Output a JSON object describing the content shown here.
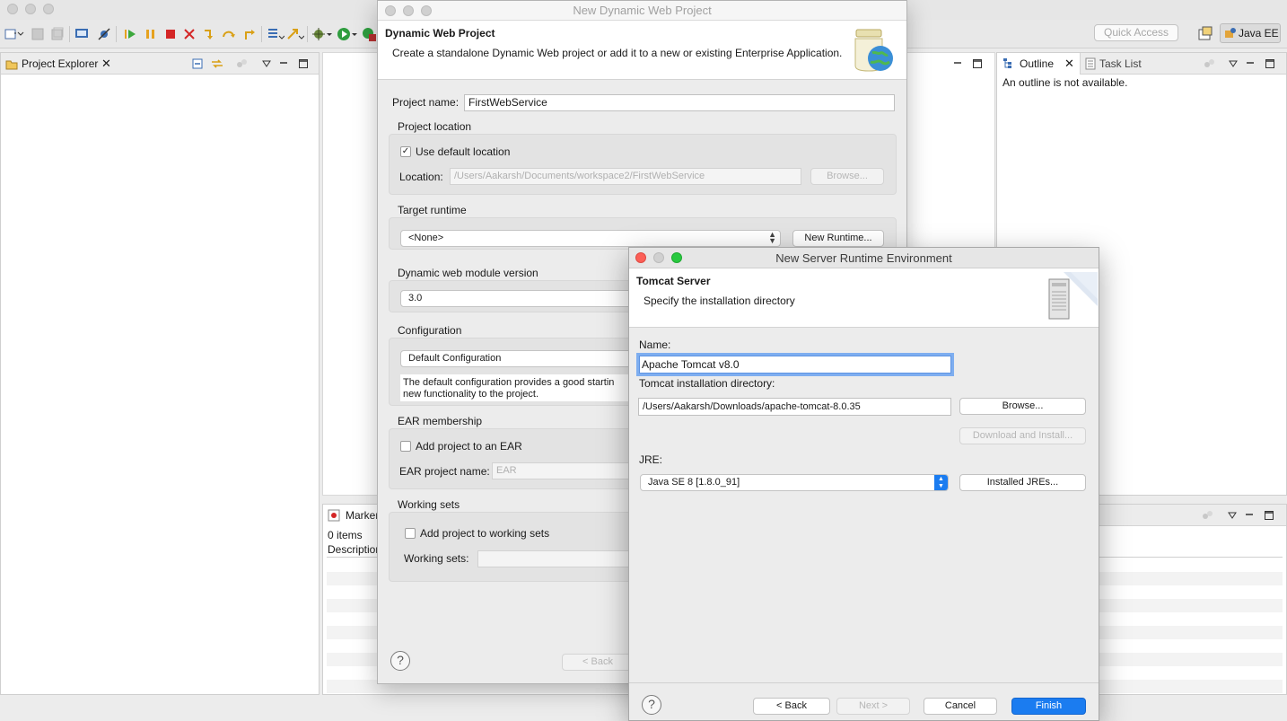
{
  "workbench": {
    "quick_access_placeholder": "Quick Access",
    "perspective_label": "Java EE",
    "project_explorer_tab": "Project Explorer",
    "outline_tab": "Outline",
    "task_list_tab": "Task List",
    "outline_message": "An outline is not available.",
    "markers_tab": "Markers",
    "markers_count": "0 items",
    "markers_col_description": "Description"
  },
  "dialog_web_project": {
    "window_title": "New Dynamic Web Project",
    "banner_title": "Dynamic Web Project",
    "banner_message": "Create a standalone Dynamic Web project or add it to a new or existing Enterprise Application.",
    "project_name_label": "Project name:",
    "project_name_value": "FirstWebService",
    "project_location_heading": "Project location",
    "use_default_location_label": "Use default location",
    "use_default_location_checked": true,
    "location_label": "Location:",
    "location_value": "/Users/Aakarsh/Documents/workspace2/FirstWebService",
    "browse_label": "Browse...",
    "target_runtime_heading": "Target runtime",
    "target_runtime_value": "<None>",
    "new_runtime_label": "New Runtime...",
    "module_version_heading": "Dynamic web module version",
    "module_version_value": "3.0",
    "configuration_heading": "Configuration",
    "configuration_value": "Default Configuration",
    "configuration_description_line1": "The default configuration provides a good startin",
    "configuration_description_line2": "new functionality to the project.",
    "ear_heading": "EAR membership",
    "add_to_ear_label": "Add project to an EAR",
    "ear_project_name_label": "EAR project name:",
    "ear_project_name_placeholder": "EAR",
    "working_sets_heading": "Working sets",
    "add_to_working_sets_label": "Add project to working sets",
    "working_sets_label": "Working sets:",
    "back_label": "< Back",
    "help_glyph": "?"
  },
  "dialog_server_runtime": {
    "window_title": "New Server Runtime Environment",
    "banner_title": "Tomcat Server",
    "banner_message": "Specify the installation directory",
    "name_label": "Name:",
    "name_value": "Apache Tomcat v8.0",
    "install_dir_label": "Tomcat installation directory:",
    "install_dir_value": "/Users/Aakarsh/Downloads/apache-tomcat-8.0.35",
    "browse_label": "Browse...",
    "download_install_label": "Download and Install...",
    "jre_label": "JRE:",
    "jre_value": "Java SE 8 [1.8.0_91]",
    "installed_jres_label": "Installed JREs...",
    "back_label": "< Back",
    "next_label": "Next >",
    "cancel_label": "Cancel",
    "finish_label": "Finish",
    "help_glyph": "?"
  },
  "colors": {
    "primary_button": "#1b7cf0",
    "close_light": "#fc5f57",
    "minimize_light": "#d0d0d0",
    "zoom_light": "#29c940",
    "focus_ring": "#7eaef0"
  }
}
